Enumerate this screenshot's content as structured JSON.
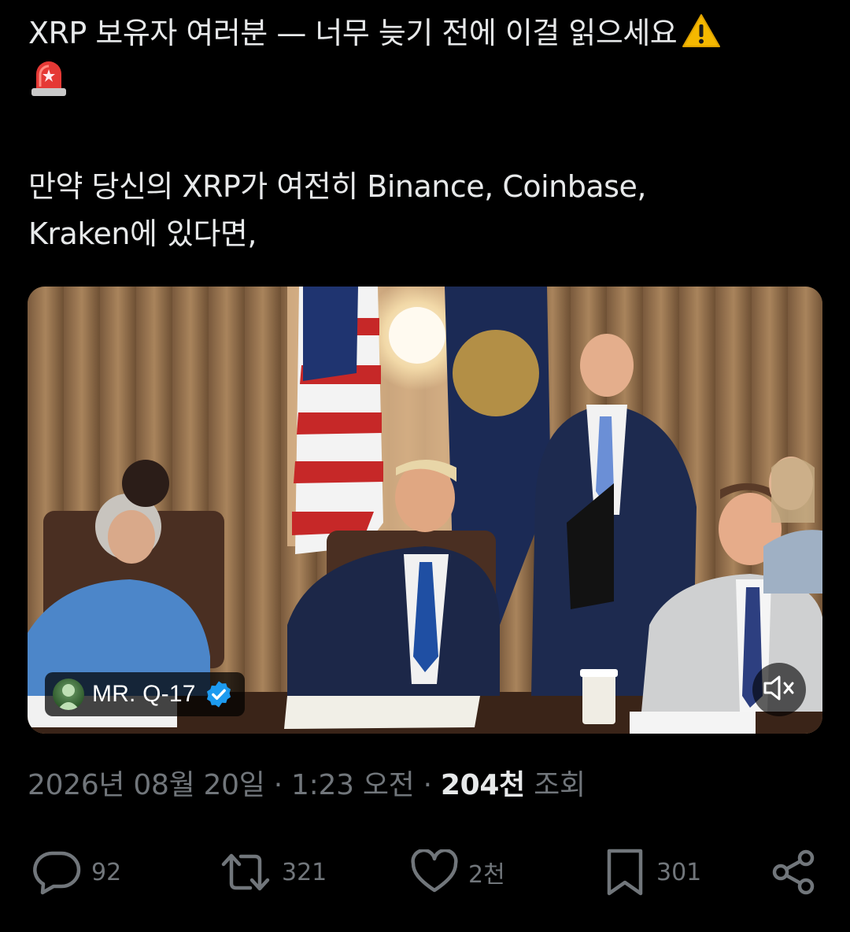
{
  "tweet": {
    "line1": "XRP 보유자 여러분 — 너무 늦기 전에 이걸 읽으세요",
    "warning_emoji": "⚠️",
    "siren_emoji": "🚨",
    "line3": "만약 당신의 XRP가 여전히 Binance, Coinbase,",
    "line4": "Kraken에 있다면,"
  },
  "media": {
    "author_name": "MR. Q-17",
    "mute_icon": "speaker-muted-icon",
    "verified_icon": "verified-badge-icon"
  },
  "meta": {
    "date": "2026년 08월 20일",
    "separator1": " · ",
    "time": "1:23 오전",
    "separator2": " · ",
    "views_count": "204천",
    "views_label": " 조회"
  },
  "actions": {
    "reply_count": "92",
    "retweet_count": "321",
    "like_count": "2천",
    "bookmark_count": "301"
  },
  "colors": {
    "background": "#000000",
    "text_primary": "#e7e9ea",
    "text_secondary": "#71767b",
    "verified_blue": "#1d9bf0"
  }
}
